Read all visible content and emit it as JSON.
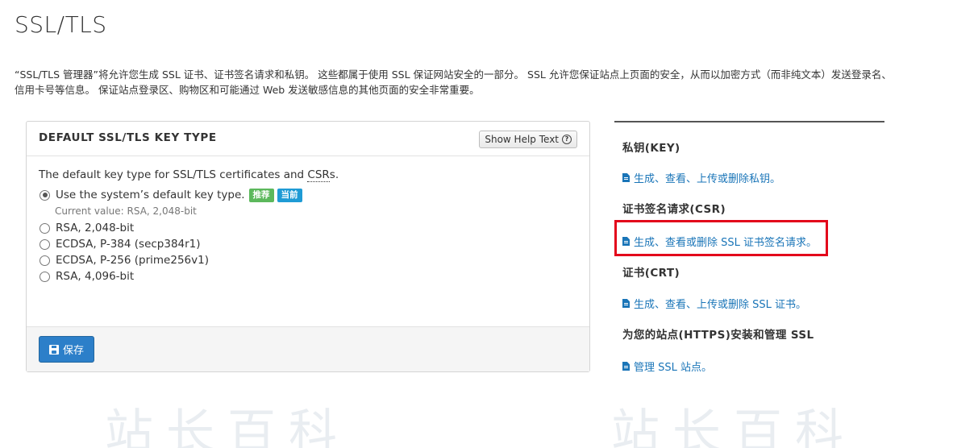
{
  "page": {
    "title": "SSL/TLS",
    "intro": "“SSL/TLS 管理器”将允许您生成 SSL 证书、证书签名请求和私钥。 这些都属于使用 SSL 保证网站安全的一部分。 SSL 允许您保证站点上页面的安全，从而以加密方式（而非纯文本）发送登录名、信用卡号等信息。 保证站点登录区、购物区和可能通过 Web 发送敏感信息的其他页面的安全非常重要。"
  },
  "panel": {
    "heading": "DEFAULT SSL/TLS KEY TYPE",
    "help_button": "Show Help Text",
    "help_icon": "question-circle-icon",
    "description_prefix": "The default key type for SSL/TLS certificates and ",
    "description_abbr": "CSR",
    "description_suffix": "s.",
    "options": [
      {
        "label": "Use the system’s default key type.",
        "checked": true
      },
      {
        "label": "RSA, 2,048-bit",
        "checked": false
      },
      {
        "label": "ECDSA, P-384 (secp384r1)",
        "checked": false
      },
      {
        "label": "ECDSA, P-256 (prime256v1)",
        "checked": false
      },
      {
        "label": "RSA, 4,096-bit",
        "checked": false
      }
    ],
    "badge_recommended": "推荐",
    "badge_current": "当前",
    "current_value": "Current value: RSA, 2,048-bit",
    "save_button": "保存",
    "save_icon": "floppy-disk-icon"
  },
  "sidebar": {
    "key_heading": "私钥(KEY)",
    "key_link": "生成、查看、上传或删除私钥。",
    "csr_heading": "证书签名请求(CSR)",
    "csr_link": "生成、查看或删除 SSL 证书签名请求。",
    "crt_heading": "证书(CRT)",
    "crt_link": "生成、查看、上传或删除 SSL 证书。",
    "install_heading": "为您的站点(HTTPS)安装和管理 SSL",
    "install_link": "管理 SSL 站点。",
    "link_icon": "file-icon"
  },
  "watermark": "站长百科",
  "colors": {
    "link": "#1a75b8",
    "primary_button": "#2c7fc9",
    "badge_green": "#5cb85c",
    "badge_blue": "#1f9bd5",
    "highlight_box": "#e3051b"
  }
}
